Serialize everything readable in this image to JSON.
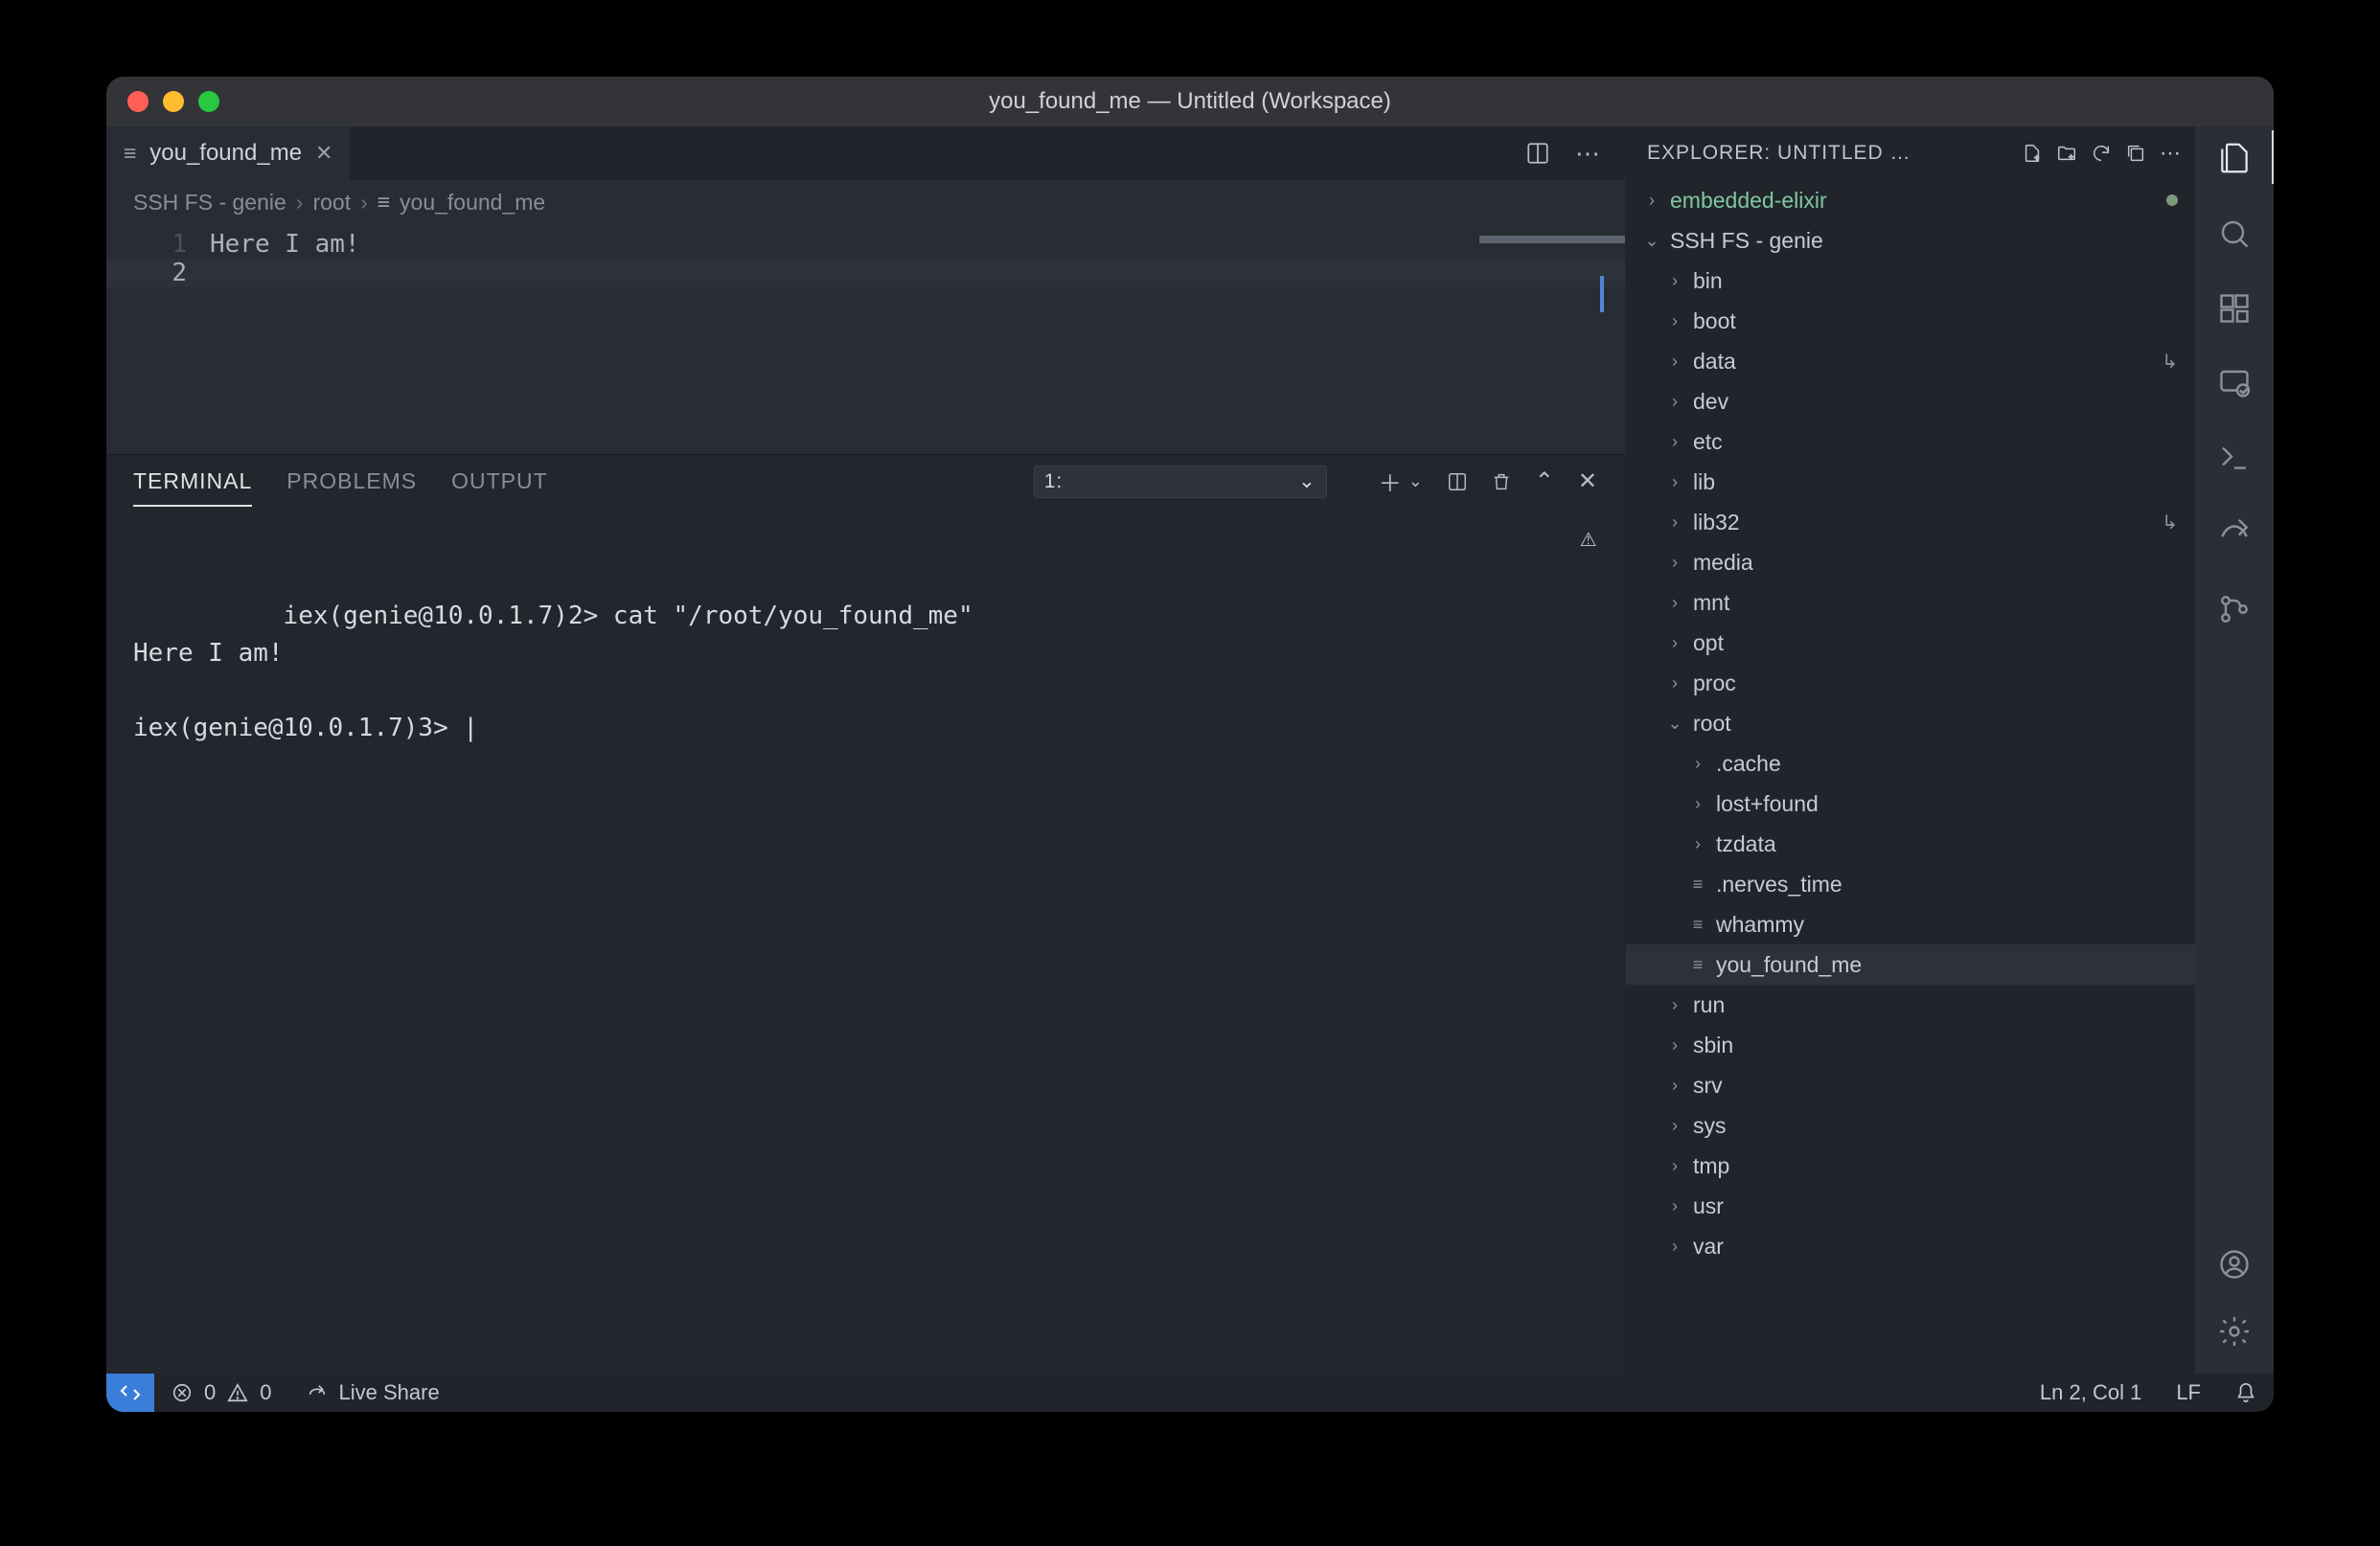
{
  "window": {
    "title": "you_found_me — Untitled (Workspace)"
  },
  "tab": {
    "filename": "you_found_me"
  },
  "breadcrumb": {
    "seg1": "SSH FS - genie",
    "seg2": "root",
    "seg3": "you_found_me"
  },
  "editor": {
    "line1_no": "1",
    "line1_text": "Here I am!",
    "line2_no": "2",
    "line2_text": ""
  },
  "panel": {
    "tab_terminal": "TERMINAL",
    "tab_problems": "PROBLEMS",
    "tab_output": "OUTPUT",
    "term_select_label": "1:",
    "terminal_lines": "iex(genie@10.0.1.7)2> cat \"/root/you_found_me\"\nHere I am!\n\niex(genie@10.0.1.7)3> |"
  },
  "explorer": {
    "title": "EXPLORER: UNTITLED …",
    "tree": [
      {
        "depth": 0,
        "kind": "folder-closed",
        "name": "embedded-elixir",
        "class": "embedded",
        "dot": true
      },
      {
        "depth": 0,
        "kind": "folder-open",
        "name": "SSH FS - genie"
      },
      {
        "depth": 1,
        "kind": "folder-closed",
        "name": "bin"
      },
      {
        "depth": 1,
        "kind": "folder-closed",
        "name": "boot"
      },
      {
        "depth": 1,
        "kind": "folder-closed",
        "name": "data",
        "link": true
      },
      {
        "depth": 1,
        "kind": "folder-closed",
        "name": "dev"
      },
      {
        "depth": 1,
        "kind": "folder-closed",
        "name": "etc"
      },
      {
        "depth": 1,
        "kind": "folder-closed",
        "name": "lib"
      },
      {
        "depth": 1,
        "kind": "folder-closed",
        "name": "lib32",
        "link": true
      },
      {
        "depth": 1,
        "kind": "folder-closed",
        "name": "media"
      },
      {
        "depth": 1,
        "kind": "folder-closed",
        "name": "mnt"
      },
      {
        "depth": 1,
        "kind": "folder-closed",
        "name": "opt"
      },
      {
        "depth": 1,
        "kind": "folder-closed",
        "name": "proc"
      },
      {
        "depth": 1,
        "kind": "folder-open",
        "name": "root"
      },
      {
        "depth": 2,
        "kind": "folder-closed",
        "name": ".cache"
      },
      {
        "depth": 2,
        "kind": "folder-closed",
        "name": "lost+found"
      },
      {
        "depth": 2,
        "kind": "folder-closed",
        "name": "tzdata"
      },
      {
        "depth": 2,
        "kind": "file",
        "name": ".nerves_time"
      },
      {
        "depth": 2,
        "kind": "file",
        "name": "whammy"
      },
      {
        "depth": 2,
        "kind": "file",
        "name": "you_found_me",
        "sel": true
      },
      {
        "depth": 1,
        "kind": "folder-closed",
        "name": "run"
      },
      {
        "depth": 1,
        "kind": "folder-closed",
        "name": "sbin"
      },
      {
        "depth": 1,
        "kind": "folder-closed",
        "name": "srv"
      },
      {
        "depth": 1,
        "kind": "folder-closed",
        "name": "sys"
      },
      {
        "depth": 1,
        "kind": "folder-closed",
        "name": "tmp"
      },
      {
        "depth": 1,
        "kind": "folder-closed",
        "name": "usr"
      },
      {
        "depth": 1,
        "kind": "folder-closed",
        "name": "var"
      }
    ]
  },
  "status": {
    "errors": "0",
    "warnings": "0",
    "live_share": "Live Share",
    "position": "Ln 2, Col 1",
    "eol": "LF"
  }
}
